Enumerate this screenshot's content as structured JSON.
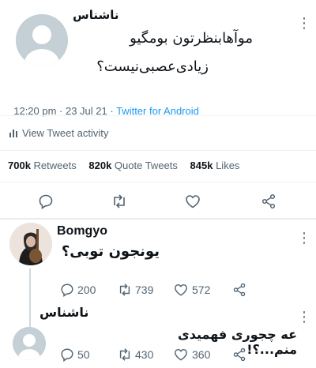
{
  "tweet": {
    "author": "ناشناس",
    "text_line1": "موآهابنظرتون بومگیو",
    "text_line2": "زیادی‌عصبی‌نیست؟",
    "time": "12:20 pm · 23 Jul 21 · ",
    "source": "Twitter for Android",
    "view_activity": "View Tweet activity",
    "retweets_count": "700k",
    "retweets_label": "Retweets",
    "quotes_count": "820k",
    "quotes_label": "Quote Tweets",
    "likes_count": "845k",
    "likes_label": "Likes"
  },
  "reply1": {
    "author": "Bomgyo",
    "text": "یونجون توبی؟",
    "replies": "200",
    "retweets": "739",
    "likes": "572"
  },
  "reply2": {
    "author": "ناشناس",
    "text": "عه چجوری فهمیدی منم...؟!",
    "replies": "50",
    "retweets": "430",
    "likes": "360"
  },
  "colors": {
    "accent": "#1d9bf0",
    "muted": "#536471",
    "avatar": "#cfd9de"
  },
  "icons": [
    "more-icon",
    "activity-icon",
    "reply-icon",
    "retweet-icon",
    "like-icon",
    "share-icon",
    "guitar-avatar"
  ]
}
